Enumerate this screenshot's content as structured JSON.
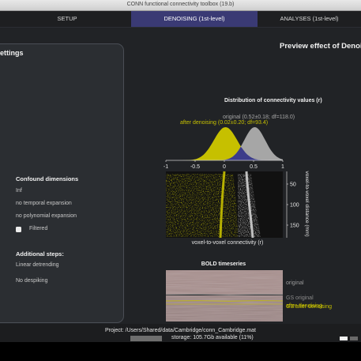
{
  "window": {
    "title": "CONN functional connectivity toolbox (19.b)"
  },
  "tabs": [
    {
      "label": "SETUP"
    },
    {
      "label": "DENOISING (1st-level)"
    },
    {
      "label": "ANALYSES (1st-level)"
    }
  ],
  "left_panel": {
    "title": "ettings",
    "confound_header": "Confound dimensions",
    "confound_dim_value": "Inf",
    "temporal": "no temporal expansion",
    "polynomial": "no polynomial expansion",
    "filtered_label": "Filtered",
    "additional_header": "Additional steps:",
    "detrending": "Linear detrending",
    "despiking": "No despiking"
  },
  "preview": {
    "title": "Preview effect of Denoising",
    "dist_title": "Distribution of connectivity values (r)",
    "original_label": "original (0.52±0.18; df=118.0)",
    "denoised_label": "after denoising (0.02±0.20; df=93.4)",
    "x_ticks": [
      "-1",
      "-0.5",
      "0",
      "0.5",
      "1"
    ],
    "y_ticks": [
      "50",
      "100",
      "150"
    ],
    "scatter_xlabel": "voxel-to-voxel connectivity (r)",
    "scatter_ylabel": "voxel-to-voxel distance (mm)",
    "bold_title": "BOLD timeseries",
    "bold_original": "original",
    "bold_denoised": "after denoising",
    "gs_original": "GS original",
    "gs_denoised": "GS after denoising"
  },
  "colors": {
    "original": "#a6a6a6",
    "denoised": "#c6c000",
    "overlap": "#3c3c8a",
    "tab_active": "#3a3a74"
  },
  "status": {
    "project": "Project: /Users/Shared/data/Cambridge/conn_Cambridge.mat",
    "storage": "storage: 105.7Gb available (11%)"
  }
}
